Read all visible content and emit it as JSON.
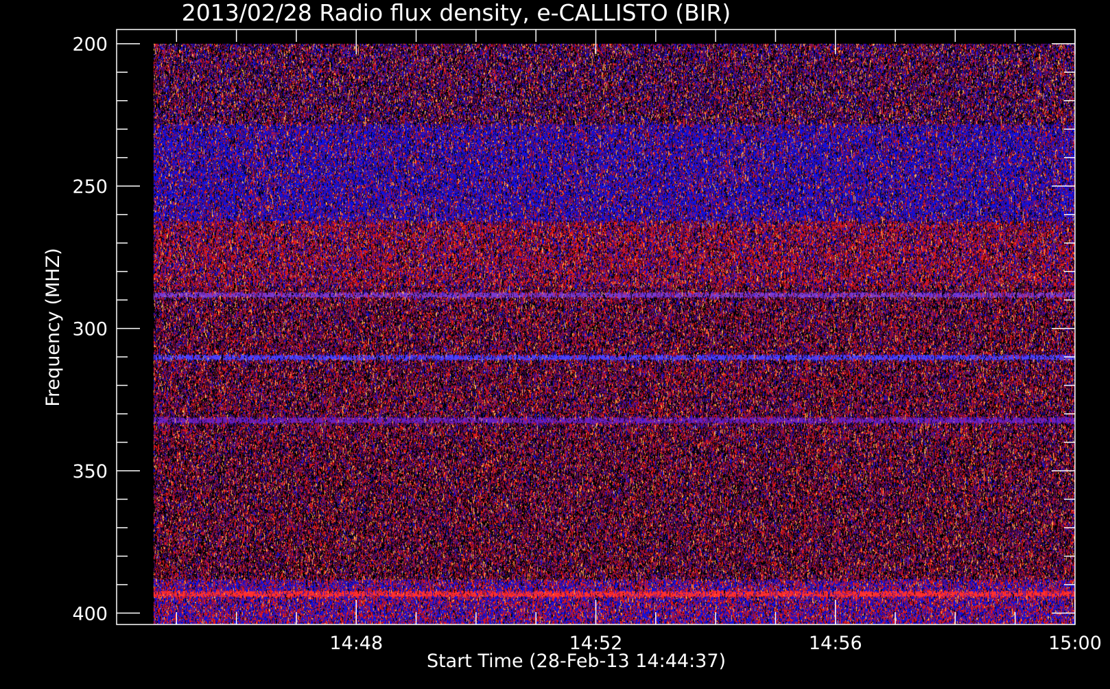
{
  "chart_data": {
    "type": "heatmap",
    "title": "2013/02/28  Radio flux density, e-CALLISTO (BIR)",
    "xlabel": "Start Time (28-Feb-13 14:44:37)",
    "ylabel": "Frequency (MHZ)",
    "x_range": [
      "14:44:37",
      "15:00:00"
    ],
    "xlim": [
      "14:44:00",
      "15:00:00"
    ],
    "x_ticks": [
      "14:48",
      "14:52",
      "14:56",
      "15:00"
    ],
    "y_range": [
      200,
      404
    ],
    "ylim": [
      195,
      404
    ],
    "y_ticks": [
      200,
      250,
      300,
      350,
      400
    ],
    "y_axis_inverted": true,
    "colors": {
      "background": "#000000",
      "axes": "#ffffff",
      "low": "#000000",
      "mid_low": "#5a0a5a",
      "mid": "#1010e0",
      "mid_high": "#e01818",
      "high": "#ffb050"
    },
    "features": [
      {
        "type": "band",
        "freq_range_mhz": [
          228,
          262
        ],
        "dominant_color": "#1010e0"
      },
      {
        "type": "band",
        "freq_range_mhz": [
          262,
          285
        ],
        "dominant_color": "#c01040"
      },
      {
        "type": "line",
        "freq_mhz": 288,
        "dominant_color": "#7a3ad0"
      },
      {
        "type": "line",
        "freq_mhz": 310,
        "dominant_color": "#4a40ff"
      },
      {
        "type": "line",
        "freq_mhz": 332,
        "dominant_color": "#6a20c0"
      },
      {
        "type": "band",
        "freq_range_mhz": [
          388,
          404
        ],
        "dominant_color": "#1010e0"
      },
      {
        "type": "line",
        "freq_mhz": 393,
        "dominant_color": "#ff3030"
      }
    ]
  }
}
